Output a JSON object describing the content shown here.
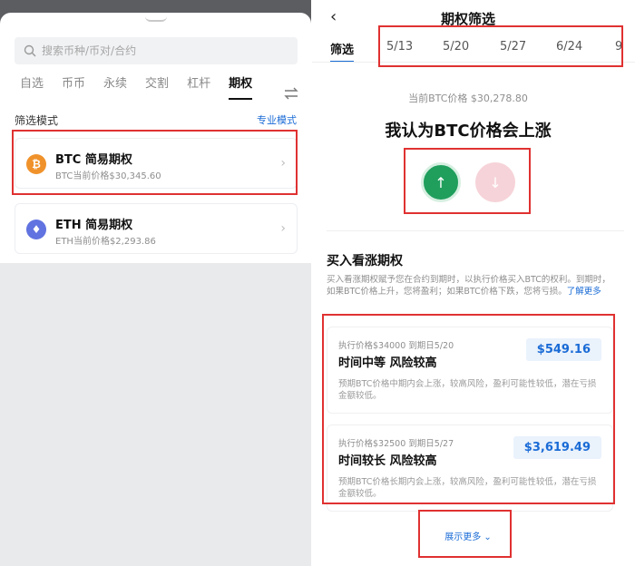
{
  "left": {
    "markets": [
      "自选",
      "币币",
      "永续",
      "交割",
      "杠杆",
      "期权"
    ],
    "active_market": "期权",
    "search_placeholder": "搜索币种/币对/合约",
    "section_title": "筛选模式",
    "pro_link": "专业模式",
    "cards": [
      {
        "title": "BTC 简易期权",
        "subtitle": "BTC当前价格$30,345.60",
        "icon": "bitcoin-icon",
        "coin_glyph": "₿"
      },
      {
        "title": "ETH 简易期权",
        "subtitle": "ETH当前价格$2,293.86",
        "icon": "ethereum-icon",
        "coin_glyph": "♦"
      }
    ]
  },
  "right": {
    "title": "期权筛选",
    "tabs": [
      "筛选",
      "5/13",
      "5/20",
      "5/27",
      "6/24",
      "9"
    ],
    "active_tab": "筛选",
    "current_price": "当前BTC价格 $30,278.80",
    "headline": "我认为BTC价格会上涨",
    "up_glyph": "↑",
    "down_glyph": "↓",
    "section_title": "买入看涨期权",
    "description": "买入看涨期权赋予您在合约到期时，以执行价格买入BTC的权利。到期时，如果BTC价格上升，您将盈利；如果BTC价格下跌，您将亏损。",
    "learn_more": "了解更多",
    "options": [
      {
        "meta": "执行价格$34000 到期日5/20",
        "title": "时间中等  风险较高",
        "price": "$549.16",
        "note": "预期BTC价格中期内会上涨，较高风险，盈利可能性较低，潜在亏损金额较低。"
      },
      {
        "meta": "执行价格$32500 到期日5/27",
        "title": "时间较长  风险较高",
        "price": "$3,619.49",
        "note": "预期BTC价格长期内会上涨，较高风险，盈利可能性较低，潜在亏损金额较低。"
      }
    ],
    "show_more": "展示更多 ⌄"
  },
  "colors": {
    "accent": "#1a6bd6",
    "up": "#1f9e5c",
    "down": "#f6d3d8",
    "annotation": "#e03131"
  }
}
